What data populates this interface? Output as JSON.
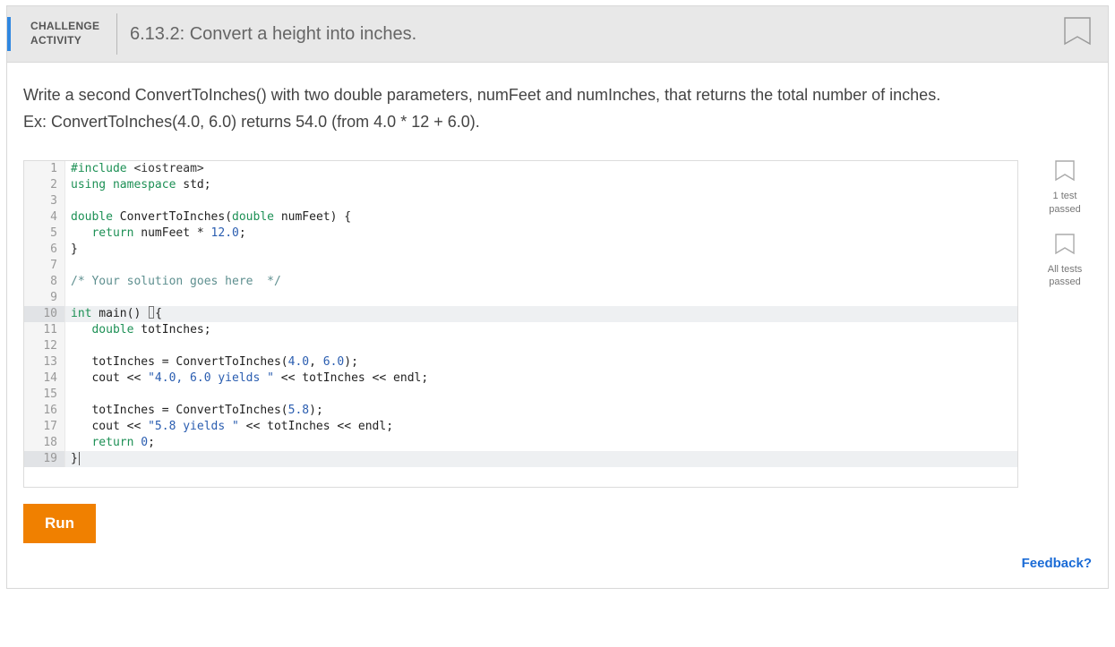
{
  "header": {
    "activity_label_line1": "CHALLENGE",
    "activity_label_line2": "ACTIVITY",
    "title": "6.13.2: Convert a height into inches."
  },
  "prompt": {
    "line1": "Write a second ConvertToInches() with two double parameters, numFeet and numInches, that returns the total number of inches.",
    "line2": "Ex: ConvertToInches(4.0, 6.0) returns 54.0 (from 4.0 * 12 + 6.0)."
  },
  "code": {
    "lines": [
      {
        "n": 1,
        "hl": false,
        "html": "<span class=\"tok-pp\">#include</span> <span class=\"tok-inc\">&lt;iostream&gt;</span>"
      },
      {
        "n": 2,
        "hl": false,
        "html": "<span class=\"tok-kw\">using</span> <span class=\"tok-kw\">namespace</span> std;"
      },
      {
        "n": 3,
        "hl": false,
        "html": ""
      },
      {
        "n": 4,
        "hl": false,
        "html": "<span class=\"tok-ty\">double</span> ConvertToInches(<span class=\"tok-ty\">double</span> numFeet) {"
      },
      {
        "n": 5,
        "hl": false,
        "html": "   <span class=\"tok-kw\">return</span> numFeet * <span class=\"tok-num\">12.0</span>;"
      },
      {
        "n": 6,
        "hl": false,
        "html": "}"
      },
      {
        "n": 7,
        "hl": false,
        "html": ""
      },
      {
        "n": 8,
        "hl": false,
        "html": "<span class=\"tok-cm\">/* Your solution goes here  */</span>"
      },
      {
        "n": 9,
        "hl": false,
        "html": ""
      },
      {
        "n": 10,
        "hl": true,
        "html": "<span class=\"tok-ty\">int</span> main() <span class=\"cursor-box\"></span>{"
      },
      {
        "n": 11,
        "hl": false,
        "html": "   <span class=\"tok-ty\">double</span> totInches;"
      },
      {
        "n": 12,
        "hl": false,
        "html": ""
      },
      {
        "n": 13,
        "hl": false,
        "html": "   totInches = ConvertToInches(<span class=\"tok-num\">4.0</span>, <span class=\"tok-num\">6.0</span>);"
      },
      {
        "n": 14,
        "hl": false,
        "html": "   cout &lt;&lt; <span class=\"tok-str\">\"4.0, 6.0 yields \"</span> &lt;&lt; totInches &lt;&lt; endl;"
      },
      {
        "n": 15,
        "hl": false,
        "html": ""
      },
      {
        "n": 16,
        "hl": false,
        "html": "   totInches = ConvertToInches(<span class=\"tok-num\">5.8</span>);"
      },
      {
        "n": 17,
        "hl": false,
        "html": "   cout &lt;&lt; <span class=\"tok-str\">\"5.8 yields \"</span> &lt;&lt; totInches &lt;&lt; endl;"
      },
      {
        "n": 18,
        "hl": false,
        "html": "   <span class=\"tok-kw\">return</span> <span class=\"tok-num\">0</span>;"
      },
      {
        "n": 19,
        "hl": true,
        "html": "}<span style=\"border-left:1px solid #555; margin-left:1px;\"></span>"
      }
    ]
  },
  "status": {
    "item1": "1 test\npassed",
    "item2": "All tests\npassed"
  },
  "buttons": {
    "run": "Run"
  },
  "links": {
    "feedback": "Feedback?"
  },
  "colors": {
    "accent_blue": "#2f87e0",
    "accent_orange": "#f08000",
    "link_blue": "#1a6bd6"
  }
}
